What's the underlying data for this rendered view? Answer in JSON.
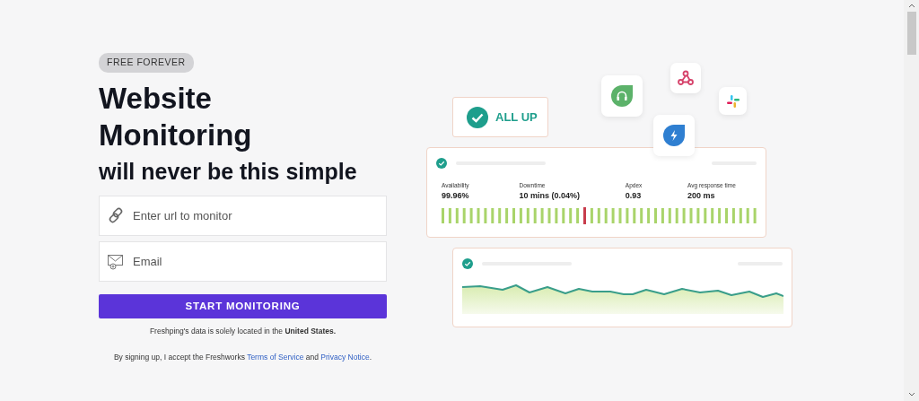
{
  "badge": "FREE FOREVER",
  "headline": [
    "Website",
    "Monitoring"
  ],
  "subheadline": "will never be this simple",
  "form": {
    "url_field": {
      "placeholder": "Enter url to monitor"
    },
    "email_field": {
      "placeholder": "Email"
    },
    "submit_button": "START MONITORING"
  },
  "data_notice": "Freshping's data is solely located in the **United States.**",
  "terms": {
    "text": "By signing up, I accept the Freshworks",
    "links": [
      "Terms of Service",
      "Privacy Notice"
    ],
    "joiner": "and",
    "end": "."
  },
  "illustration": {
    "status": "ALL UP",
    "stats": [
      {
        "label": "Availability",
        "value": "99.96%"
      },
      {
        "label": "Downtime",
        "value": "10 mins (0.04%)"
      },
      {
        "label": "Apdex",
        "value": "0.93"
      },
      {
        "label": "Avg response time",
        "value": "200 ms"
      }
    ]
  }
}
